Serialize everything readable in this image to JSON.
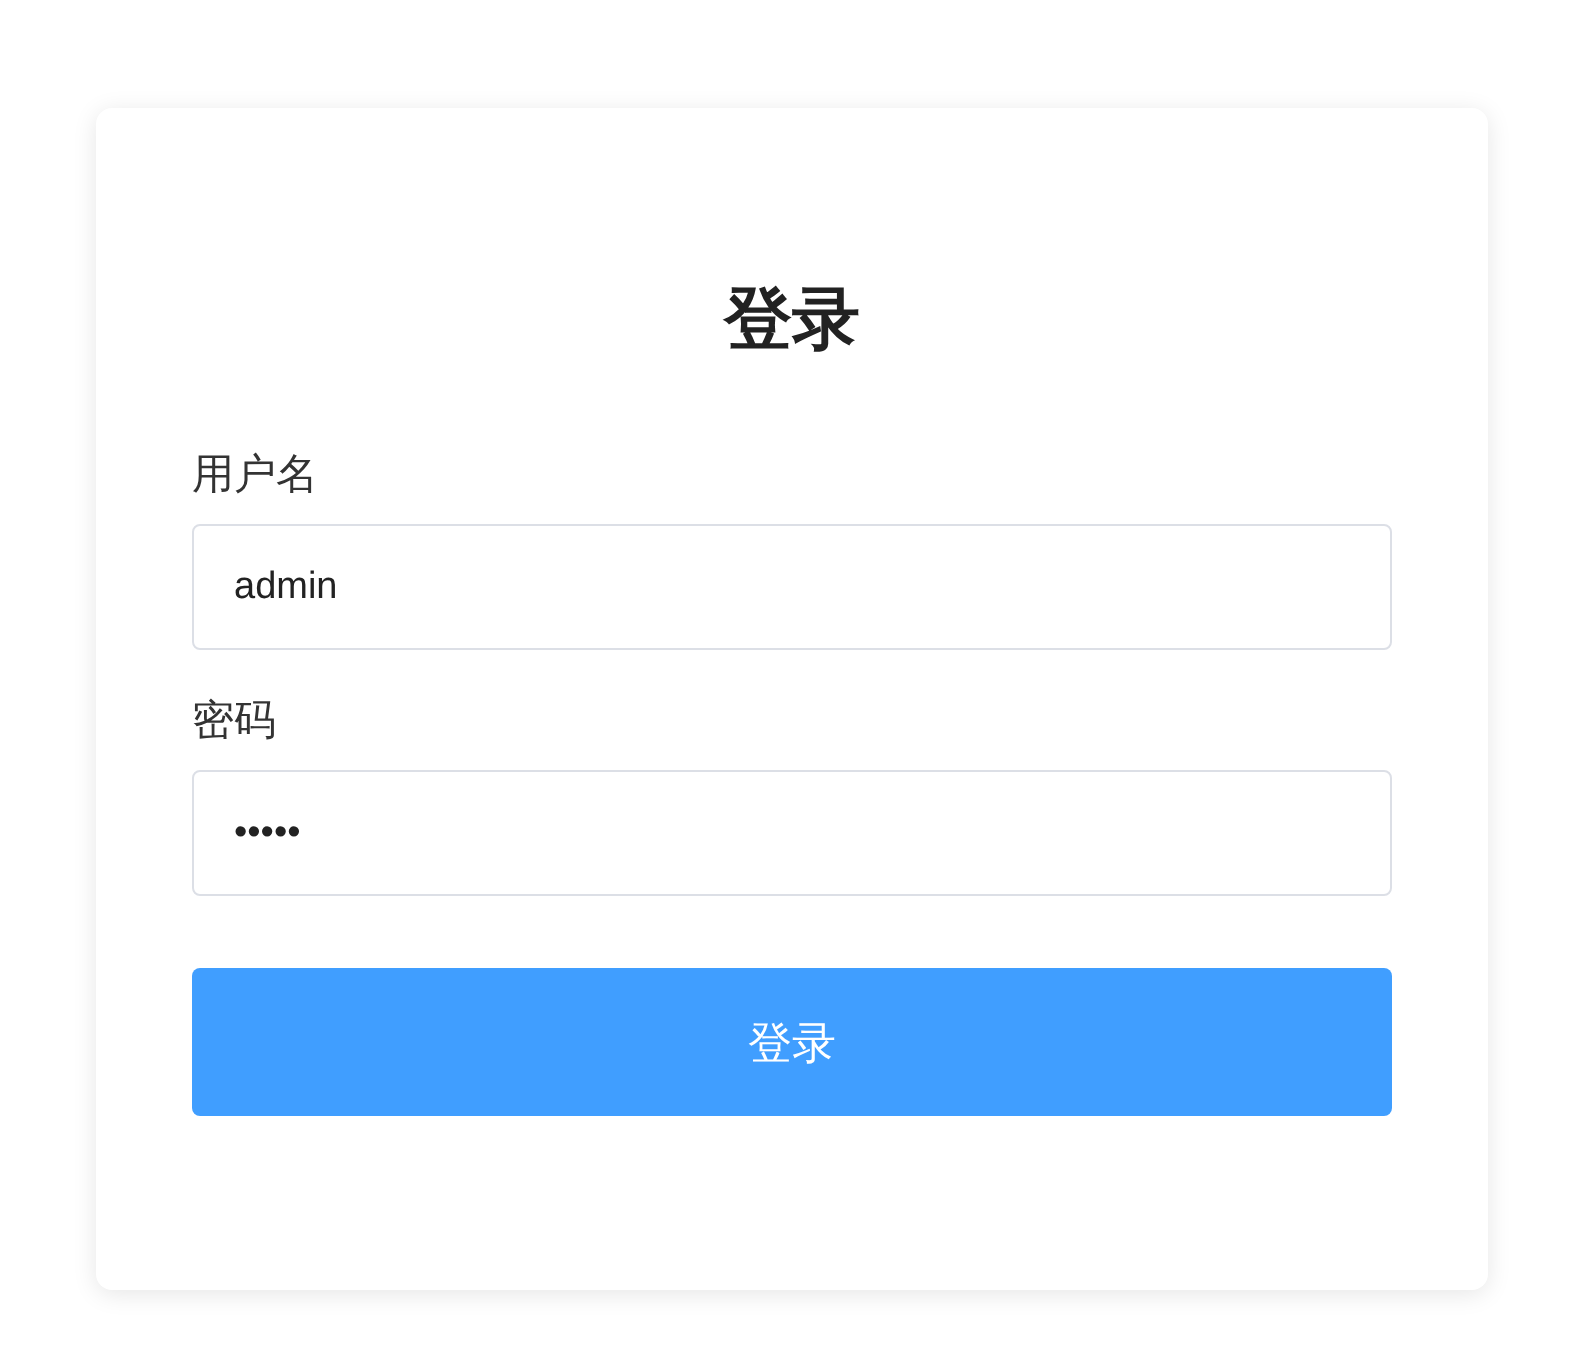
{
  "title": "登录",
  "fields": [
    {
      "label": "用户名",
      "value": "admin"
    },
    {
      "label": "密码",
      "value": "•••••"
    }
  ],
  "button": "登录"
}
